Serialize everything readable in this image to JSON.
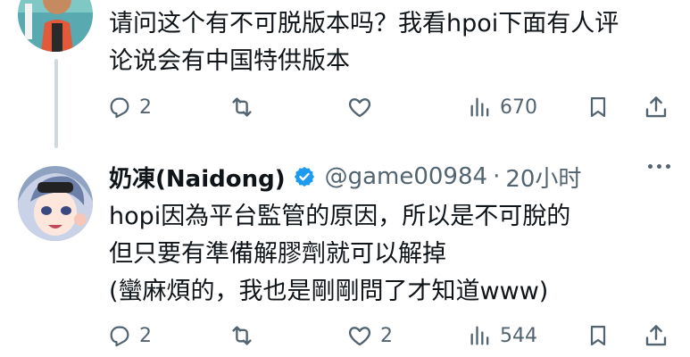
{
  "tweet1": {
    "lines": [
      "请问这个有不可脱版本吗？我看hpoi下面有人评",
      "论说会有中国特供版本"
    ],
    "reply_count": "2",
    "retweet_count": "",
    "like_count": "",
    "view_count": "670"
  },
  "tweet2": {
    "name": "奶凍(Naidong)",
    "handle": "@game00984",
    "separator": "·",
    "time": "20小时",
    "lines": [
      "hopi因為平台監管的原因，所以是不可脫的",
      "但只要有準備解膠劑就可以解掉",
      "(蠻麻煩的，我也是剛剛問了才知道www)"
    ],
    "reply_count": "2",
    "retweet_count": "",
    "like_count": "2",
    "view_count": "544"
  },
  "icons": {
    "reply": "reply-icon",
    "retweet": "retweet-icon",
    "like": "heart-icon",
    "views": "views-icon",
    "bookmark": "bookmark-icon",
    "share": "share-icon",
    "verified": "verified-badge-icon",
    "more": "more-icon"
  },
  "colors": {
    "text": "#0f1419",
    "secondary": "#536471",
    "verified": "#1d9bf0",
    "thread_line": "#cfd9de"
  }
}
